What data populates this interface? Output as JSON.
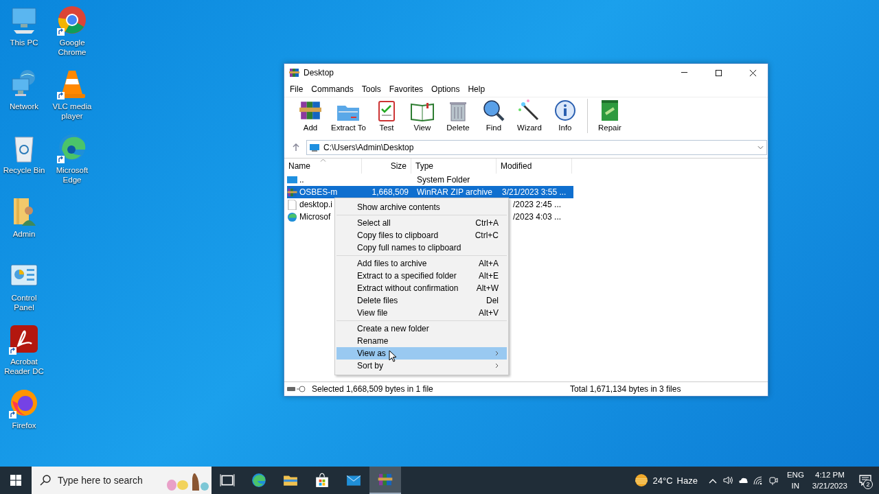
{
  "desktop_icons": [
    {
      "kind": "pc",
      "label": "This PC",
      "shortcut": false
    },
    {
      "kind": "network",
      "label": "Network",
      "shortcut": false
    },
    {
      "kind": "bin",
      "label": "Recycle Bin",
      "shortcut": false
    },
    {
      "kind": "user",
      "label": "Admin",
      "shortcut": false
    },
    {
      "kind": "panel",
      "label": "Control Panel",
      "shortcut": false
    },
    {
      "kind": "pdf",
      "label": "Acrobat Reader DC",
      "shortcut": true
    },
    {
      "kind": "firefox",
      "label": "Firefox",
      "shortcut": true
    },
    {
      "kind": "chrome",
      "label": "Google Chrome",
      "shortcut": true
    },
    {
      "kind": "vlc",
      "label": "VLC media player",
      "shortcut": true
    },
    {
      "kind": "edge",
      "label": "Microsoft Edge",
      "shortcut": true
    }
  ],
  "window": {
    "title": "Desktop",
    "menu": [
      "File",
      "Commands",
      "Tools",
      "Favorites",
      "Options",
      "Help"
    ],
    "toolbar": [
      {
        "kind": "add",
        "label": "Add"
      },
      {
        "kind": "extract",
        "label": "Extract To"
      },
      {
        "kind": "test",
        "label": "Test"
      },
      {
        "kind": "view",
        "label": "View"
      },
      {
        "kind": "delete",
        "label": "Delete"
      },
      {
        "kind": "find",
        "label": "Find"
      },
      {
        "kind": "wizard",
        "label": "Wizard"
      },
      {
        "kind": "info",
        "label": "Info"
      },
      {
        "kind": "repair",
        "label": "Repair"
      }
    ],
    "address": "C:\\Users\\Admin\\Desktop",
    "columns": [
      {
        "label": "Name",
        "sorted": true
      },
      {
        "label": "Size",
        "sorted": false
      },
      {
        "label": "Type",
        "sorted": false
      },
      {
        "label": "Modified",
        "sorted": false
      }
    ],
    "rows": [
      {
        "kind": "folder",
        "name": "..",
        "type": "System Folder",
        "selected": false
      },
      {
        "kind": "archive",
        "name": "OSBES-m",
        "size": "1,668,509",
        "type": "WinRAR ZIP archive",
        "modified": "3/21/2023 3:55 ...",
        "selected": true
      },
      {
        "kind": "file",
        "name": "desktop.i",
        "modified": "/2023 2:45 ...",
        "selected": false
      },
      {
        "kind": "edge",
        "name": "Microsof",
        "modified": "/2023 4:03 ...",
        "selected": false
      }
    ],
    "status": {
      "left": "Selected 1,668,509 bytes in 1 file",
      "right": "Total 1,671,134 bytes in 3 files"
    }
  },
  "context_menu": [
    [
      {
        "label": "Show archive contents",
        "submenu": false,
        "selected": false
      }
    ],
    [
      {
        "label": "Select all",
        "shortcut": "Ctrl+A",
        "submenu": false,
        "selected": false
      },
      {
        "label": "Copy files to clipboard",
        "shortcut": "Ctrl+C",
        "submenu": false,
        "selected": false
      },
      {
        "label": "Copy full names to clipboard",
        "submenu": false,
        "selected": false
      }
    ],
    [
      {
        "label": "Add files to archive",
        "shortcut": "Alt+A",
        "submenu": false,
        "selected": false
      },
      {
        "label": "Extract to a specified folder",
        "shortcut": "Alt+E",
        "submenu": false,
        "selected": false
      },
      {
        "label": "Extract without confirmation",
        "shortcut": "Alt+W",
        "submenu": false,
        "selected": false
      },
      {
        "label": "Delete files",
        "shortcut": "Del",
        "submenu": false,
        "selected": false
      },
      {
        "label": "View file",
        "shortcut": "Alt+V",
        "submenu": false,
        "selected": false
      }
    ],
    [
      {
        "label": "Create a new folder",
        "submenu": false,
        "selected": false
      },
      {
        "label": "Rename",
        "submenu": false,
        "selected": false
      },
      {
        "label": "View as",
        "submenu": true,
        "selected": true
      },
      {
        "label": "Sort by",
        "submenu": true,
        "selected": false
      }
    ]
  ],
  "taskbar": {
    "search_placeholder": "Type here to search",
    "apps": [
      {
        "kind": "taskview",
        "active": false
      },
      {
        "kind": "edge",
        "active": false
      },
      {
        "kind": "explorer",
        "active": false
      },
      {
        "kind": "store",
        "active": false
      },
      {
        "kind": "mail",
        "active": false
      },
      {
        "kind": "winrar",
        "active": true
      }
    ],
    "weather": {
      "temperature": "24°C",
      "condition": "Haze"
    },
    "language": [
      "ENG",
      "IN"
    ],
    "time": "4:12 PM",
    "date": "3/21/2023",
    "notifications": "2"
  }
}
